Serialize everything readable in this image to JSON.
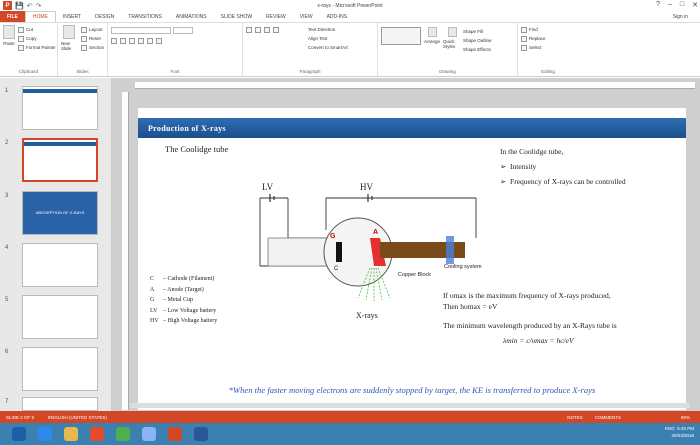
{
  "window": {
    "title": "x-rays - Microsoft PowerPoint",
    "minimize": "–",
    "maximize": "□",
    "close": "✕",
    "help": "?"
  },
  "qat": {
    "logo": "P",
    "save": "💾",
    "undo": "↶",
    "redo": "↷"
  },
  "tabs": [
    {
      "label": "FILE"
    },
    {
      "label": "HOME"
    },
    {
      "label": "INSERT"
    },
    {
      "label": "DESIGN"
    },
    {
      "label": "TRANSITIONS"
    },
    {
      "label": "ANIMATIONS"
    },
    {
      "label": "SLIDE SHOW"
    },
    {
      "label": "REVIEW"
    },
    {
      "label": "VIEW"
    },
    {
      "label": "ADD-INS"
    }
  ],
  "signin": "Sign in",
  "ribbon": {
    "clipboard": {
      "label": "Clipboard",
      "paste": "Paste",
      "cut": "Cut",
      "copy": "Copy",
      "format_painter": "Format Painter"
    },
    "slides": {
      "label": "Slides",
      "new_slide": "New Slide",
      "layout": "Layout",
      "reset": "Reset",
      "section": "Section"
    },
    "font": {
      "label": "Font"
    },
    "paragraph": {
      "label": "Paragraph",
      "text_direction": "Text Direction",
      "align_text": "Align Text",
      "smartart": "Convert to SmartArt"
    },
    "drawing": {
      "label": "Drawing",
      "arrange": "Arrange",
      "quick_styles": "Quick Styles",
      "shape_fill": "Shape Fill",
      "shape_outline": "Shape Outline",
      "shape_effects": "Shape Effects"
    },
    "editing": {
      "label": "Editing",
      "find": "Find",
      "replace": "Replace",
      "select": "Select"
    }
  },
  "thumbnails": [
    {
      "num": "1",
      "band": ""
    },
    {
      "num": "2",
      "band": ""
    },
    {
      "num": "3",
      "band": "ABSORPTION OF X-RAYS"
    },
    {
      "num": "4",
      "band": ""
    },
    {
      "num": "5",
      "band": ""
    },
    {
      "num": "6",
      "band": ""
    },
    {
      "num": "7",
      "band": ""
    }
  ],
  "slide": {
    "header": "Production of X-rays",
    "subtitle": "The Coolidge tube",
    "bullets_intro": "In the Coolidge tube,",
    "bullets": [
      "Intensity",
      "Frequency of X-rays can be controlled"
    ],
    "diagram": {
      "lv": "LV",
      "hv": "HV",
      "g": "G",
      "a": "A",
      "c": "C",
      "copper": "Copper Block",
      "cooling": "Cooling system",
      "xrays": "X-rays"
    },
    "legend": [
      {
        "key": "C",
        "text": "– Cathode (Filament)"
      },
      {
        "key": "A",
        "text": "– Anode (Target)"
      },
      {
        "key": "G",
        "text": "– Metal Cup"
      },
      {
        "key": "LV",
        "text": "– Low Voltage battery"
      },
      {
        "key": "HV",
        "text": "– High Voltage battery"
      }
    ],
    "info_line1": "If υmax is the maximum frequency of X-rays produced,",
    "info_line2": "Then hυmax = eV",
    "info_line3": "The minimum wavelength produced by an X-Rays tube is",
    "formula": "λmin = c/υmax = hc/eV",
    "footnote": "*When the faster moving electrons are suddenly stopped by target, the KE is transferred to produce X-rays"
  },
  "status": {
    "slide": "SLIDE 2 OF 9",
    "lang": "ENGLISH (UNITED STATES)",
    "notes": "NOTES",
    "comments": "COMMENTS",
    "zoom": "80%"
  },
  "taskbar": {
    "time": "5:40 PM",
    "date": "26/03/2016",
    "lang": "ENG"
  }
}
